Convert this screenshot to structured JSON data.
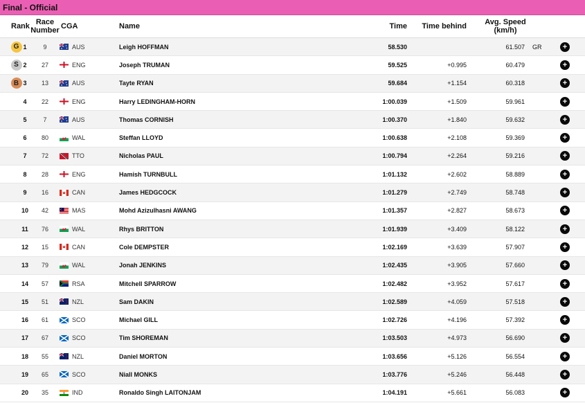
{
  "banner": {
    "title": "Final  -  Official"
  },
  "columns": {
    "rank": "Rank",
    "race_number_1": "Race",
    "race_number_2": "Number",
    "cga": "CGA",
    "name": "Name",
    "time": "Time",
    "time_behind": "Time behind",
    "avg_speed_1": "Avg. Speed",
    "avg_speed_2": "(km/h)"
  },
  "rows": [
    {
      "rank": "1",
      "medal": "G",
      "medal_color": "#f5c542",
      "race": "9",
      "cga": "AUS",
      "name": "Leigh HOFFMAN",
      "time": "58.530",
      "behind": "",
      "speed": "61.507",
      "record": "GR"
    },
    {
      "rank": "2",
      "medal": "S",
      "medal_color": "#c9c9c9",
      "race": "27",
      "cga": "ENG",
      "name": "Joseph TRUMAN",
      "time": "59.525",
      "behind": "+0.995",
      "speed": "60.479",
      "record": ""
    },
    {
      "rank": "3",
      "medal": "B",
      "medal_color": "#d98b55",
      "race": "13",
      "cga": "AUS",
      "name": "Tayte RYAN",
      "time": "59.684",
      "behind": "+1.154",
      "speed": "60.318",
      "record": ""
    },
    {
      "rank": "4",
      "medal": "",
      "race": "22",
      "cga": "ENG",
      "name": "Harry LEDINGHAM-HORN",
      "time": "1:00.039",
      "behind": "+1.509",
      "speed": "59.961",
      "record": ""
    },
    {
      "rank": "5",
      "medal": "",
      "race": "7",
      "cga": "AUS",
      "name": "Thomas CORNISH",
      "time": "1:00.370",
      "behind": "+1.840",
      "speed": "59.632",
      "record": ""
    },
    {
      "rank": "6",
      "medal": "",
      "race": "80",
      "cga": "WAL",
      "name": "Steffan LLOYD",
      "time": "1:00.638",
      "behind": "+2.108",
      "speed": "59.369",
      "record": ""
    },
    {
      "rank": "7",
      "medal": "",
      "race": "72",
      "cga": "TTO",
      "name": "Nicholas PAUL",
      "time": "1:00.794",
      "behind": "+2.264",
      "speed": "59.216",
      "record": ""
    },
    {
      "rank": "8",
      "medal": "",
      "race": "28",
      "cga": "ENG",
      "name": "Hamish TURNBULL",
      "time": "1:01.132",
      "behind": "+2.602",
      "speed": "58.889",
      "record": ""
    },
    {
      "rank": "9",
      "medal": "",
      "race": "16",
      "cga": "CAN",
      "name": "James HEDGCOCK",
      "time": "1:01.279",
      "behind": "+2.749",
      "speed": "58.748",
      "record": ""
    },
    {
      "rank": "10",
      "medal": "",
      "race": "42",
      "cga": "MAS",
      "name": "Mohd Azizulhasni AWANG",
      "time": "1:01.357",
      "behind": "+2.827",
      "speed": "58.673",
      "record": ""
    },
    {
      "rank": "11",
      "medal": "",
      "race": "76",
      "cga": "WAL",
      "name": "Rhys BRITTON",
      "time": "1:01.939",
      "behind": "+3.409",
      "speed": "58.122",
      "record": ""
    },
    {
      "rank": "12",
      "medal": "",
      "race": "15",
      "cga": "CAN",
      "name": "Cole DEMPSTER",
      "time": "1:02.169",
      "behind": "+3.639",
      "speed": "57.907",
      "record": ""
    },
    {
      "rank": "13",
      "medal": "",
      "race": "79",
      "cga": "WAL",
      "name": "Jonah JENKINS",
      "time": "1:02.435",
      "behind": "+3.905",
      "speed": "57.660",
      "record": ""
    },
    {
      "rank": "14",
      "medal": "",
      "race": "57",
      "cga": "RSA",
      "name": "Mitchell SPARROW",
      "time": "1:02.482",
      "behind": "+3.952",
      "speed": "57.617",
      "record": ""
    },
    {
      "rank": "15",
      "medal": "",
      "race": "51",
      "cga": "NZL",
      "name": "Sam DAKIN",
      "time": "1:02.589",
      "behind": "+4.059",
      "speed": "57.518",
      "record": ""
    },
    {
      "rank": "16",
      "medal": "",
      "race": "61",
      "cga": "SCO",
      "name": "Michael GILL",
      "time": "1:02.726",
      "behind": "+4.196",
      "speed": "57.392",
      "record": ""
    },
    {
      "rank": "17",
      "medal": "",
      "race": "67",
      "cga": "SCO",
      "name": "Tim SHOREMAN",
      "time": "1:03.503",
      "behind": "+4.973",
      "speed": "56.690",
      "record": ""
    },
    {
      "rank": "18",
      "medal": "",
      "race": "55",
      "cga": "NZL",
      "name": "Daniel MORTON",
      "time": "1:03.656",
      "behind": "+5.126",
      "speed": "56.554",
      "record": ""
    },
    {
      "rank": "19",
      "medal": "",
      "race": "65",
      "cga": "SCO",
      "name": "Niall MONKS",
      "time": "1:03.776",
      "behind": "+5.246",
      "speed": "56.448",
      "record": ""
    },
    {
      "rank": "20",
      "medal": "",
      "race": "35",
      "cga": "IND",
      "name": "Ronaldo Singh LAITONJAM",
      "time": "1:04.191",
      "behind": "+5.661",
      "speed": "56.083",
      "record": ""
    }
  ],
  "expand_icon": "plus-circle-icon"
}
